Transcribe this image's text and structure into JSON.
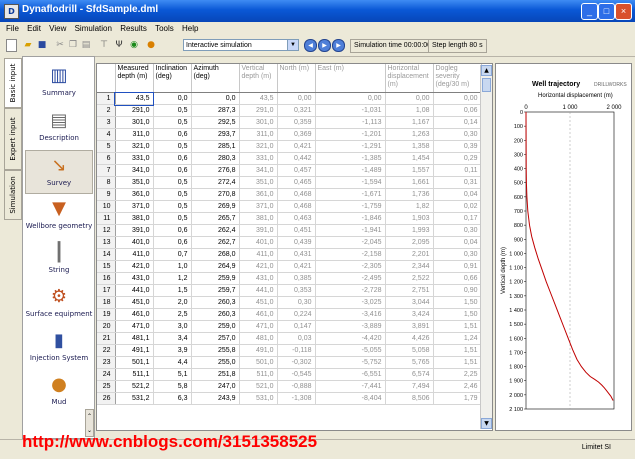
{
  "window": {
    "title": "Dynaflodrill - SfdSample.dml"
  },
  "menu": [
    "File",
    "Edit",
    "View",
    "Simulation",
    "Results",
    "Tools",
    "Help"
  ],
  "toolbar": {
    "mode_select": "Interactive simulation",
    "simulation_time": "Simulation time 00:00:00",
    "step_length": "Step length 80 s"
  },
  "vertical_tabs": [
    "Basic input",
    "Expert input",
    "Simulation"
  ],
  "sidebar": [
    {
      "label": "Summary",
      "icon": "summary-icon"
    },
    {
      "label": "Description",
      "icon": "description-icon"
    },
    {
      "label": "Survey",
      "icon": "survey-icon",
      "selected": true
    },
    {
      "label": "Wellbore geometry",
      "icon": "wellbore-icon"
    },
    {
      "label": "String",
      "icon": "string-icon"
    },
    {
      "label": "Surface equipment",
      "icon": "surface-equipment-icon"
    },
    {
      "label": "Injection System",
      "icon": "injection-system-icon"
    },
    {
      "label": "Mud",
      "icon": "mud-icon"
    }
  ],
  "table": {
    "columns": [
      {
        "label": "Measured depth (m)",
        "editable": true
      },
      {
        "label": "Inclination (deg)",
        "editable": true
      },
      {
        "label": "Azimuth (deg)",
        "editable": true
      },
      {
        "label": "Vertical depth (m)",
        "editable": false
      },
      {
        "label": "North (m)",
        "editable": false
      },
      {
        "label": "East (m)",
        "editable": false
      },
      {
        "label": "Horizontal displacement (m)",
        "editable": false
      },
      {
        "label": "Dogleg severity (deg/30 m)",
        "editable": false
      }
    ],
    "rows": [
      [
        "1",
        "43,5",
        "0,0",
        "0,0",
        "43,5",
        "0,00",
        "0,00",
        "0,00",
        "0,00"
      ],
      [
        "2",
        "291,0",
        "0,5",
        "287,3",
        "291,0",
        "0,321",
        "-1,031",
        "1,08",
        "0,06"
      ],
      [
        "3",
        "301,0",
        "0,5",
        "292,5",
        "301,0",
        "0,359",
        "-1,113",
        "1,167",
        "0,14"
      ],
      [
        "4",
        "311,0",
        "0,6",
        "293,7",
        "311,0",
        "0,369",
        "-1,201",
        "1,263",
        "0,30"
      ],
      [
        "5",
        "321,0",
        "0,5",
        "285,1",
        "321,0",
        "0,421",
        "-1,291",
        "1,358",
        "0,39"
      ],
      [
        "6",
        "331,0",
        "0,6",
        "280,3",
        "331,0",
        "0,442",
        "-1,385",
        "1,454",
        "0,29"
      ],
      [
        "7",
        "341,0",
        "0,6",
        "276,8",
        "341,0",
        "0,457",
        "-1,489",
        "1,557",
        "0,11"
      ],
      [
        "8",
        "351,0",
        "0,5",
        "272,4",
        "351,0",
        "0,465",
        "-1,594",
        "1,661",
        "0,31"
      ],
      [
        "9",
        "361,0",
        "0,5",
        "270,8",
        "361,0",
        "0,468",
        "-1,671",
        "1,736",
        "0,04"
      ],
      [
        "10",
        "371,0",
        "0,5",
        "269,9",
        "371,0",
        "0,468",
        "-1,759",
        "1,82",
        "0,02"
      ],
      [
        "11",
        "381,0",
        "0,5",
        "265,7",
        "381,0",
        "0,463",
        "-1,846",
        "1,903",
        "0,17"
      ],
      [
        "12",
        "391,0",
        "0,6",
        "262,4",
        "391,0",
        "0,451",
        "-1,941",
        "1,993",
        "0,30"
      ],
      [
        "13",
        "401,0",
        "0,6",
        "262,7",
        "401,0",
        "0,439",
        "-2,045",
        "2,095",
        "0,04"
      ],
      [
        "14",
        "411,0",
        "0,7",
        "268,0",
        "411,0",
        "0,431",
        "-2,158",
        "2,201",
        "0,30"
      ],
      [
        "15",
        "421,0",
        "1,0",
        "264,9",
        "421,0",
        "0,421",
        "-2,305",
        "2,344",
        "0,91"
      ],
      [
        "16",
        "431,0",
        "1,2",
        "259,9",
        "431,0",
        "0,385",
        "-2,495",
        "2,522",
        "0,66"
      ],
      [
        "17",
        "441,0",
        "1,5",
        "259,7",
        "441,0",
        "0,353",
        "-2,728",
        "2,751",
        "0,90"
      ],
      [
        "18",
        "451,0",
        "2,0",
        "260,3",
        "451,0",
        "0,30",
        "-3,025",
        "3,044",
        "1,50"
      ],
      [
        "19",
        "461,0",
        "2,5",
        "260,3",
        "461,0",
        "0,224",
        "-3,416",
        "3,424",
        "1,50"
      ],
      [
        "20",
        "471,0",
        "3,0",
        "259,0",
        "471,0",
        "0,147",
        "-3,889",
        "3,891",
        "1,51"
      ],
      [
        "21",
        "481,1",
        "3,4",
        "257,0",
        "481,0",
        "0,03",
        "-4,420",
        "4,426",
        "1,24"
      ],
      [
        "22",
        "491,1",
        "3,9",
        "255,8",
        "491,0",
        "-0,118",
        "-5,055",
        "5,058",
        "1,51"
      ],
      [
        "23",
        "501,1",
        "4,4",
        "255,0",
        "501,0",
        "-0,302",
        "-5,752",
        "5,765",
        "1,51"
      ],
      [
        "24",
        "511,1",
        "5,1",
        "251,8",
        "511,0",
        "-0,545",
        "-6,551",
        "6,574",
        "2,25"
      ],
      [
        "25",
        "521,2",
        "5,8",
        "247,0",
        "521,0",
        "-0,888",
        "-7,441",
        "7,494",
        "2,46"
      ],
      [
        "26",
        "531,2",
        "6,3",
        "243,9",
        "531,0",
        "-1,308",
        "-8,404",
        "8,506",
        "1,79"
      ]
    ]
  },
  "chart_data": {
    "type": "line",
    "title": "Well trajectory",
    "logo": "DRILLWORKS",
    "xlabel": "Horizontal displacement (m)",
    "ylabel": "Vertical depth (m)",
    "xlim": [
      0,
      2000
    ],
    "ylim": [
      0,
      2100
    ],
    "x_ticks": [
      "0",
      "1 000",
      "2 000"
    ],
    "y_ticks": [
      "0",
      "100",
      "200",
      "300",
      "400",
      "500",
      "600",
      "700",
      "800",
      "900",
      "1 000",
      "1 100",
      "1 200",
      "1 300",
      "1 400",
      "1 500",
      "1 600",
      "1 700",
      "1 800",
      "1 900",
      "2 000",
      "2 100"
    ],
    "series": [
      {
        "x": [
          0,
          5,
          10,
          20,
          40,
          80,
          130,
          200,
          280,
          370,
          460,
          560,
          660,
          760,
          860,
          960,
          1060,
          1160,
          1260,
          1360,
          1460,
          1560,
          1650,
          1720,
          1780,
          1830,
          1880,
          1930,
          1980
        ],
        "y": [
          0,
          400,
          500,
          600,
          700,
          800,
          880,
          960,
          1040,
          1120,
          1200,
          1280,
          1360,
          1440,
          1520,
          1600,
          1680,
          1750,
          1800,
          1840,
          1870,
          1890,
          1910,
          1930,
          1950,
          1970,
          1990,
          2010,
          2040
        ]
      }
    ],
    "grid": true,
    "colors": {
      "series": "#c00000"
    }
  },
  "status": {
    "unit_system": "Limitet SI"
  },
  "watermark": "http://www.cnblogs.com/3151358525"
}
